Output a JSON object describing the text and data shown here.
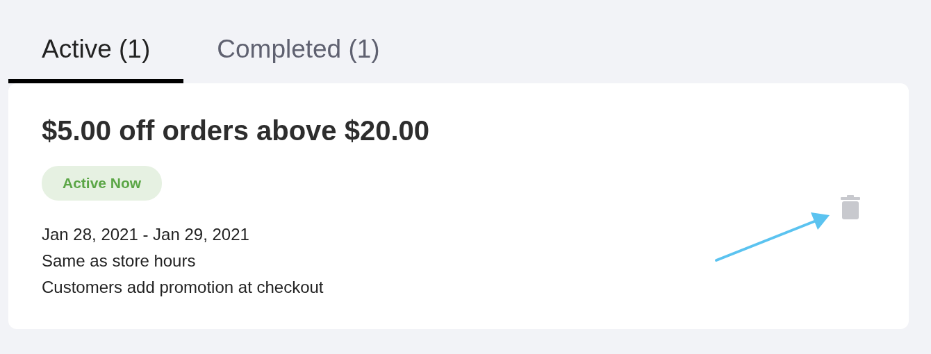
{
  "tabs": [
    {
      "label": "Active (1)",
      "selected": true
    },
    {
      "label": "Completed (1)",
      "selected": false
    }
  ],
  "promotion": {
    "title": "$5.00 off orders above $20.00",
    "status": "Active Now",
    "details": [
      "Jan 28, 2021 - Jan 29, 2021",
      "Same as store hours",
      "Customers add promotion at checkout"
    ]
  }
}
